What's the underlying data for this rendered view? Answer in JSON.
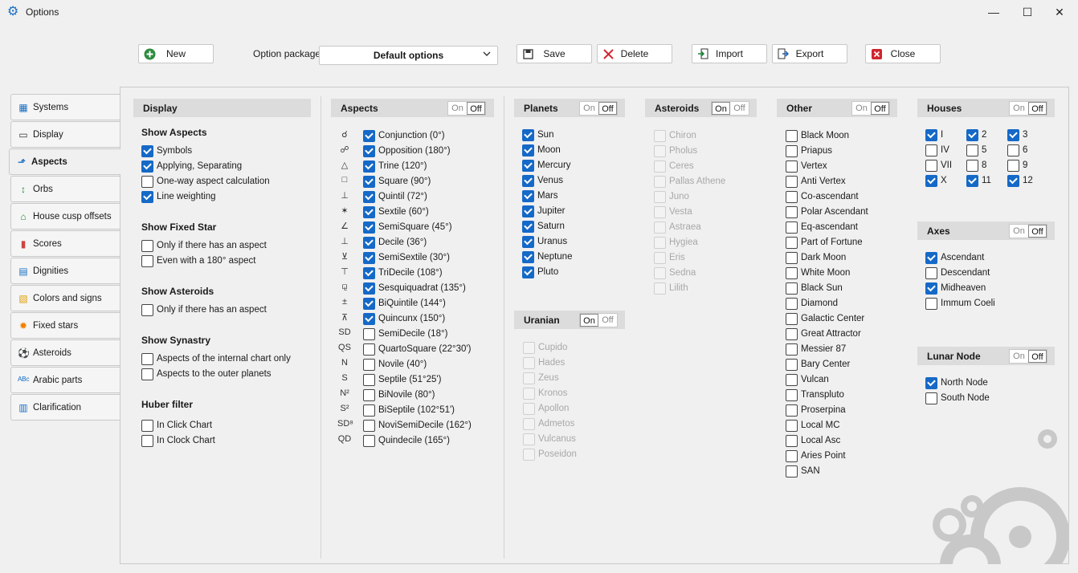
{
  "window": {
    "title": "Options"
  },
  "toolbar": {
    "new": "New",
    "option_package_label": "Option package",
    "option_package_value": "Default options",
    "save": "Save",
    "delete": "Delete",
    "import": "Import",
    "export": "Export",
    "close": "Close"
  },
  "tabs": [
    "Systems",
    "Display",
    "Aspects",
    "Orbs",
    "House cusp offsets",
    "Scores",
    "Dignities",
    "Colors and signs",
    "Fixed stars",
    "Asteroids",
    "Arabic parts",
    "Clarification"
  ],
  "toggle": {
    "on": "On",
    "off": "Off"
  },
  "display": {
    "title": "Display",
    "show_aspects": "Show Aspects",
    "symbols": "Symbols",
    "applying": "Applying, Separating",
    "oneway": "One-way aspect calculation",
    "line_weighting": "Line weighting",
    "show_fixed_star": "Show Fixed Star",
    "fs_only": "Only if there has an aspect",
    "fs_even": "Even with a 180° aspect",
    "show_asteroids": "Show Asteroids",
    "ast_only": "Only if there has an aspect",
    "show_synastry": "Show Synastry",
    "syn_internal": "Aspects of the internal chart only",
    "syn_outer": "Aspects to the outer planets",
    "huber": "Huber filter",
    "huber_click": "In Click Chart",
    "huber_clock": "In Clock Chart"
  },
  "aspects": {
    "title": "Aspects",
    "items": [
      {
        "sym": "☌",
        "label": "Conjunction (0°)",
        "on": true
      },
      {
        "sym": "☍",
        "label": "Opposition (180°)",
        "on": true
      },
      {
        "sym": "△",
        "label": "Trine (120°)",
        "on": true
      },
      {
        "sym": "□",
        "label": "Square (90°)",
        "on": true
      },
      {
        "sym": "⊥",
        "label": "Quintil (72°)",
        "on": true
      },
      {
        "sym": "✶",
        "label": "Sextile (60°)",
        "on": true
      },
      {
        "sym": "∠",
        "label": "SemiSquare (45°)",
        "on": true
      },
      {
        "sym": "⊥",
        "label": "Decile (36°)",
        "on": true
      },
      {
        "sym": "⊻",
        "label": "SemiSextile (30°)",
        "on": true
      },
      {
        "sym": "⊤",
        "label": "TriDecile (108°)",
        "on": true
      },
      {
        "sym": "⚼",
        "label": "Sesquiquadrat (135°)",
        "on": true
      },
      {
        "sym": "±",
        "label": "BiQuintile (144°)",
        "on": true
      },
      {
        "sym": "⊼",
        "label": "Quincunx (150°)",
        "on": true
      },
      {
        "sym": "SD",
        "label": "SemiDecile (18°)",
        "on": false
      },
      {
        "sym": "QS",
        "label": "QuartoSquare (22°30')",
        "on": false
      },
      {
        "sym": "N",
        "label": "Novile (40°)",
        "on": false
      },
      {
        "sym": "S",
        "label": "Septile (51°25')",
        "on": false
      },
      {
        "sym": "N²",
        "label": "BiNovile (80°)",
        "on": false
      },
      {
        "sym": "S²",
        "label": "BiSeptile (102°51')",
        "on": false
      },
      {
        "sym": "SD⁸",
        "label": "NoviSemiDecile (162°)",
        "on": false
      },
      {
        "sym": "QD",
        "label": "Quindecile (165°)",
        "on": false
      }
    ]
  },
  "planets": {
    "title": "Planets",
    "items": [
      "Sun",
      "Moon",
      "Mercury",
      "Venus",
      "Mars",
      "Jupiter",
      "Saturn",
      "Uranus",
      "Neptune",
      "Pluto"
    ]
  },
  "uranian": {
    "title": "Uranian",
    "items": [
      "Cupido",
      "Hades",
      "Zeus",
      "Kronos",
      "Apollon",
      "Admetos",
      "Vulcanus",
      "Poseidon"
    ]
  },
  "asteroids": {
    "title": "Asteroids",
    "items": [
      "Chiron",
      "Pholus",
      "Ceres",
      "Pallas Athene",
      "Juno",
      "Vesta",
      "Astraea",
      "Hygiea",
      "Eris",
      "Sedna",
      "Lilith"
    ]
  },
  "other": {
    "title": "Other",
    "items": [
      "Black Moon",
      "Priapus",
      "Vertex",
      "Anti Vertex",
      "Co-ascendant",
      "Polar Ascendant",
      "Eq-ascendant",
      "Part of Fortune",
      "Dark Moon",
      "White Moon",
      "Black Sun",
      "Diamond",
      "Galactic Center",
      "Great Attractor",
      "Messier 87",
      "Bary Center",
      "Vulcan",
      "Transpluto",
      "Proserpina",
      "Local MC",
      "Local Asc",
      "Aries Point",
      "SAN"
    ]
  },
  "houses": {
    "title": "Houses",
    "items": [
      {
        "l": "I",
        "on": true
      },
      {
        "l": "2",
        "on": true
      },
      {
        "l": "3",
        "on": true
      },
      {
        "l": "IV",
        "on": false
      },
      {
        "l": "5",
        "on": false
      },
      {
        "l": "6",
        "on": false
      },
      {
        "l": "VII",
        "on": false
      },
      {
        "l": "8",
        "on": false
      },
      {
        "l": "9",
        "on": false
      },
      {
        "l": "X",
        "on": true
      },
      {
        "l": "11",
        "on": true
      },
      {
        "l": "12",
        "on": true
      }
    ]
  },
  "axes": {
    "title": "Axes",
    "items": [
      {
        "l": "Ascendant",
        "on": true
      },
      {
        "l": "Descendant",
        "on": false
      },
      {
        "l": "Midheaven",
        "on": true
      },
      {
        "l": "Immum Coeli",
        "on": false
      }
    ]
  },
  "lunar": {
    "title": "Lunar Node",
    "items": [
      {
        "l": "North Node",
        "on": true
      },
      {
        "l": "South Node",
        "on": false
      }
    ]
  },
  "colors": {
    "accent": "#1569c7",
    "header_bg": "#dcdcdc"
  }
}
